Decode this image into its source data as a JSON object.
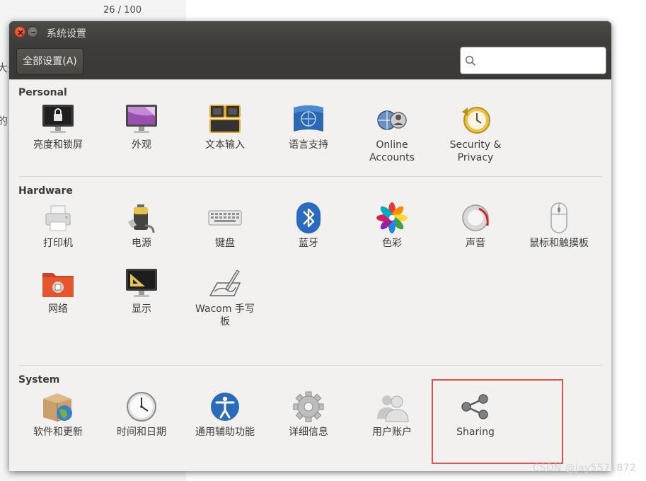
{
  "background": {
    "page_counter": "26 / 100",
    "side_text_1": "大多",
    "side_text_2": "的",
    "watermark": "CSDN @jay5571872"
  },
  "window": {
    "title": "系统设置",
    "all_settings_label": "全部设置(A)",
    "search": {
      "value": "",
      "placeholder": ""
    }
  },
  "sections": {
    "personal": {
      "title": "Personal",
      "items": [
        "亮度和锁屏",
        "外观",
        "文本输入",
        "语言支持",
        "Online\nAccounts",
        "Security &\nPrivacy"
      ]
    },
    "hardware": {
      "title": "Hardware",
      "items": [
        "打印机",
        "电源",
        "键盘",
        "蓝牙",
        "色彩",
        "声音",
        "鼠标和触摸板",
        "网络",
        "显示",
        "Wacom 手写\n板"
      ]
    },
    "system": {
      "title": "System",
      "items": [
        "软件和更新",
        "时间和日期",
        "通用辅助功能",
        "详细信息",
        "用户账户",
        "Sharing"
      ]
    }
  },
  "colors": {
    "titlebar": "#3d3c39",
    "window_bg": "#f2f1f0",
    "close_button": "#e95420",
    "highlight_box": "#d9534f"
  },
  "icons": [
    "lock-screen-icon",
    "appearance-icon",
    "text-entry-icon",
    "language-support-icon",
    "online-accounts-icon",
    "security-privacy-icon",
    "printer-icon",
    "power-icon",
    "keyboard-icon",
    "bluetooth-icon",
    "color-icon",
    "sound-icon",
    "mouse-touchpad-icon",
    "network-icon",
    "display-icon",
    "wacom-tablet-icon",
    "software-updates-icon",
    "time-date-icon",
    "accessibility-icon",
    "details-icon",
    "user-accounts-icon",
    "sharing-icon"
  ]
}
